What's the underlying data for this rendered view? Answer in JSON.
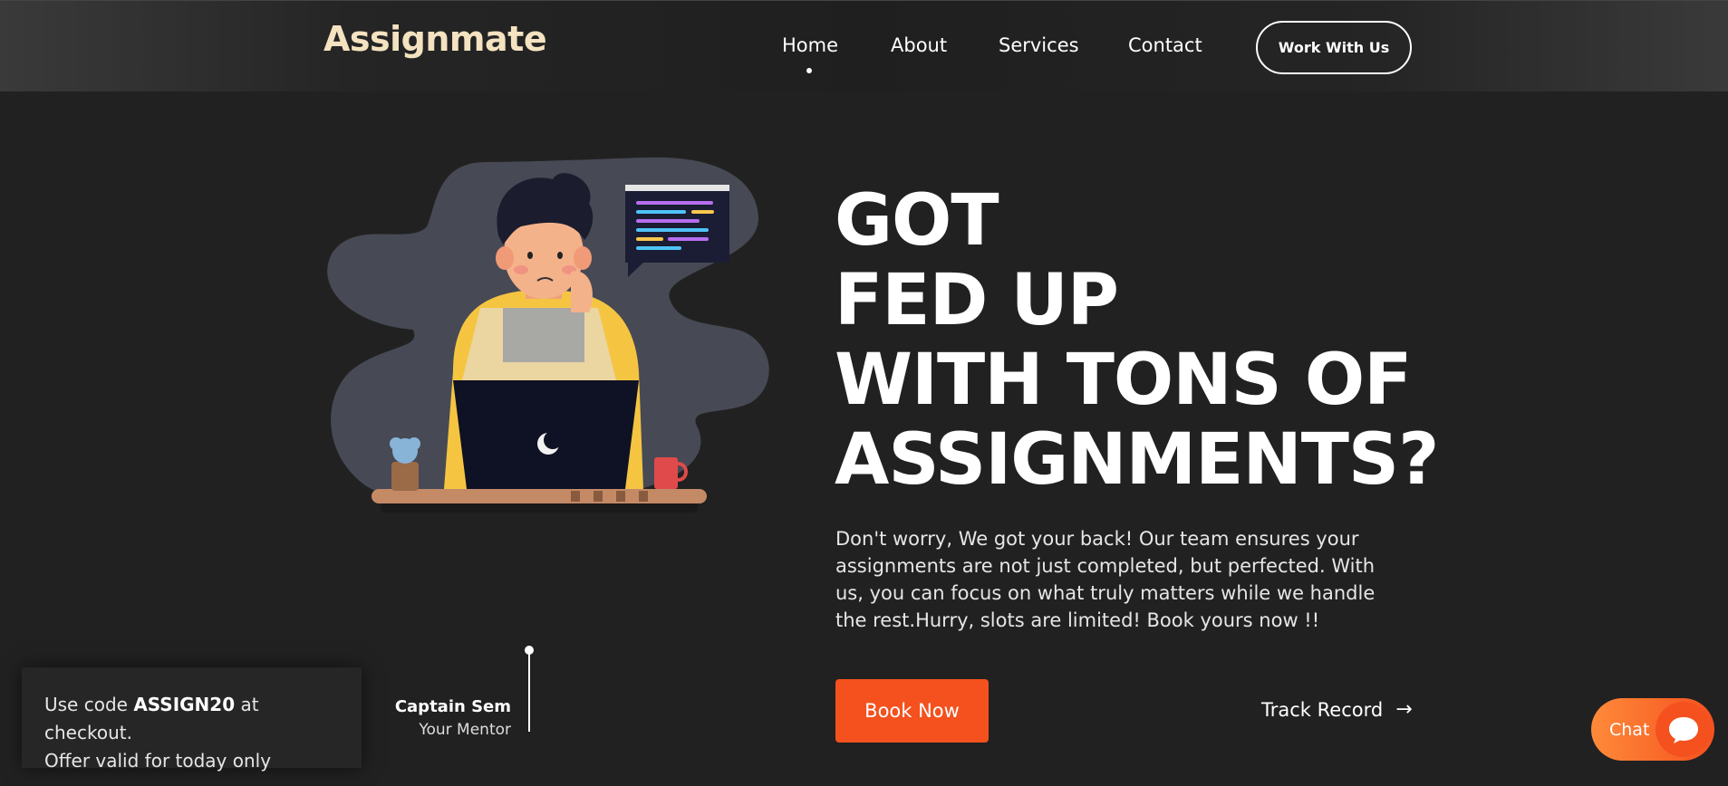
{
  "nav": {
    "logo_main": "Assignmat",
    "logo_dot_char": "·",
    "logo_end": "e",
    "links": [
      "Home",
      "About",
      "Services",
      "Contact"
    ],
    "active": "Home",
    "cta": "Work With Us"
  },
  "hero": {
    "headline": [
      "GOT",
      "FED UP",
      "WITH TONS OF",
      "ASSIGNMENTS?"
    ],
    "description": "Don't worry, We got your back! Our team ensures your assignments are not just completed, but perfected. With us, you can focus on what truly matters while we handle the rest.Hurry, slots are limited! Book yours now !!",
    "book_button": "Book Now",
    "track_link": "Track Record",
    "track_arrow": "→"
  },
  "mentor": {
    "name": "Captain Sem",
    "role": "Your Mentor"
  },
  "promo": {
    "prefix": "Use code ",
    "code": "ASSIGN20",
    "suffix": " at checkout.",
    "line2": "Offer valid for today only"
  },
  "chat": {
    "label": "Chat"
  },
  "colors": {
    "accent": "#f4511e",
    "background": "#212121",
    "logo": "#f4e2c0"
  }
}
